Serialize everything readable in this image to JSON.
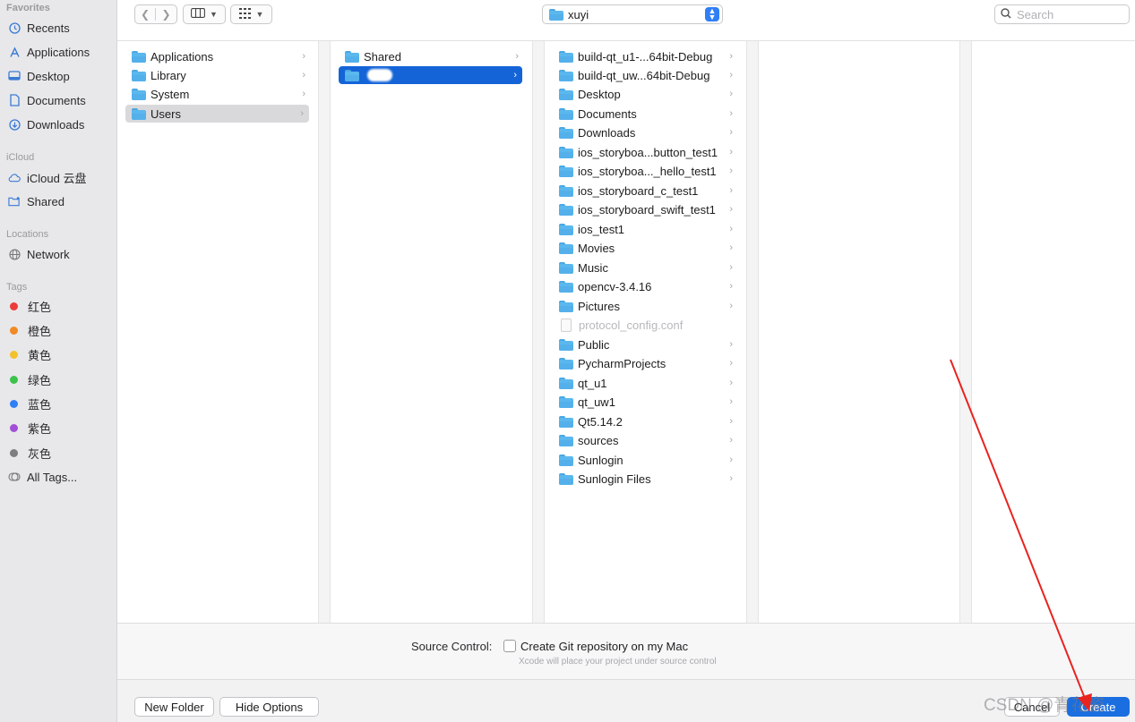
{
  "sidebar": {
    "favorites_title": "Favorites",
    "favorites": [
      {
        "label": "Recents",
        "icon": "clock-icon"
      },
      {
        "label": "Applications",
        "icon": "applications-icon"
      },
      {
        "label": "Desktop",
        "icon": "desktop-icon"
      },
      {
        "label": "Documents",
        "icon": "document-icon"
      },
      {
        "label": "Downloads",
        "icon": "download-icon"
      }
    ],
    "icloud_title": "iCloud",
    "icloud": [
      {
        "label": "iCloud 云盘",
        "icon": "cloud-icon"
      },
      {
        "label": "Shared",
        "icon": "shared-folder-icon"
      }
    ],
    "locations_title": "Locations",
    "locations": [
      {
        "label": "Network",
        "icon": "globe-icon"
      }
    ],
    "tags_title": "Tags",
    "tags": [
      {
        "label": "红色",
        "color": "#ec3b3b"
      },
      {
        "label": "橙色",
        "color": "#f08a24"
      },
      {
        "label": "黄色",
        "color": "#f2c12e"
      },
      {
        "label": "绿色",
        "color": "#3cc24a"
      },
      {
        "label": "蓝色",
        "color": "#2f7ff5"
      },
      {
        "label": "紫色",
        "color": "#a24fd6"
      },
      {
        "label": "灰色",
        "color": "#7e7e82"
      }
    ],
    "all_tags": "All Tags..."
  },
  "toolbar": {
    "path_label": "xuyi",
    "search_placeholder": "Search"
  },
  "columns": {
    "col1": [
      {
        "label": "Applications",
        "state": ""
      },
      {
        "label": "Library",
        "state": ""
      },
      {
        "label": "System",
        "state": ""
      },
      {
        "label": "Users",
        "state": "selected-inactive"
      }
    ],
    "col2": [
      {
        "label": "Shared",
        "state": ""
      },
      {
        "label": "",
        "state": "selected-active"
      }
    ],
    "col3": [
      {
        "label": "build-qt_u1-...64bit-Debug",
        "kind": "folder"
      },
      {
        "label": "build-qt_uw...64bit-Debug",
        "kind": "folder"
      },
      {
        "label": "Desktop",
        "kind": "folder"
      },
      {
        "label": "Documents",
        "kind": "folder"
      },
      {
        "label": "Downloads",
        "kind": "folder"
      },
      {
        "label": "ios_storyboa...button_test1",
        "kind": "folder"
      },
      {
        "label": "ios_storyboa..._hello_test1",
        "kind": "folder"
      },
      {
        "label": "ios_storyboard_c_test1",
        "kind": "folder"
      },
      {
        "label": "ios_storyboard_swift_test1",
        "kind": "folder"
      },
      {
        "label": "ios_test1",
        "kind": "folder"
      },
      {
        "label": "Movies",
        "kind": "folder"
      },
      {
        "label": "Music",
        "kind": "folder"
      },
      {
        "label": "opencv-3.4.16",
        "kind": "folder"
      },
      {
        "label": "Pictures",
        "kind": "folder"
      },
      {
        "label": "protocol_config.conf",
        "kind": "file"
      },
      {
        "label": "Public",
        "kind": "folder"
      },
      {
        "label": "PycharmProjects",
        "kind": "folder"
      },
      {
        "label": "qt_u1",
        "kind": "folder"
      },
      {
        "label": "qt_uw1",
        "kind": "folder"
      },
      {
        "label": "Qt5.14.2",
        "kind": "folder"
      },
      {
        "label": "sources",
        "kind": "folder"
      },
      {
        "label": "Sunlogin",
        "kind": "folder"
      },
      {
        "label": "Sunlogin Files",
        "kind": "folder"
      }
    ]
  },
  "options": {
    "source_control_label": "Source Control:",
    "create_git_label": "Create Git repository on my Mac",
    "hint": "Xcode will place your project under source control"
  },
  "bottom": {
    "new_folder": "New Folder",
    "hide_options": "Hide Options",
    "cancel": "Cancel",
    "create": "Create",
    "watermark": "CSDN @青花瓷"
  },
  "colors": {
    "accent": "#1464d8",
    "annotation_arrow": "#e8231e"
  }
}
